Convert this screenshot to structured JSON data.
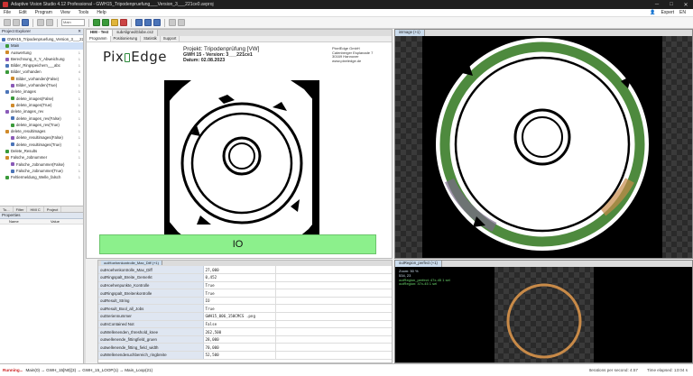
{
  "window": {
    "title": "Adaptive Vision Studio 4.12 Professional - GWH15_Tripodenpruefung___Version_3___221ce0.avproj",
    "minimize": "─",
    "maximize": "□",
    "close": "✕"
  },
  "menu": {
    "items": [
      "File",
      "Edit",
      "Program",
      "View",
      "Tools",
      "Help"
    ],
    "user": "Expert",
    "lang": "EN"
  },
  "toolbar": {
    "dropdown": "Main"
  },
  "project_explorer": {
    "title": "Project Explorer",
    "items": [
      {
        "label": "GWH15_Tripodenpruefung_Version_3___221ce0",
        "line": "",
        "sel": false
      },
      {
        "label": "Main",
        "line": "",
        "sel": true
      },
      {
        "label": "Auswertung",
        "line": "1",
        "sel": false
      },
      {
        "label": "Berechnung_X_Y_Abweichung",
        "line": "1",
        "sel": false
      },
      {
        "label": "Bilder_Ringspeichern___abc",
        "line": "1",
        "sel": false
      },
      {
        "label": "Bilder_vorhanden",
        "line": "4",
        "sel": false
      },
      {
        "label": "Bilder_vorhanden(False)",
        "line": "1",
        "sel": false
      },
      {
        "label": "Bilder_vorhanden(True)",
        "line": "1",
        "sel": false
      },
      {
        "label": "delete_images",
        "line": "1",
        "sel": false
      },
      {
        "label": "delete_images(False)",
        "line": "1",
        "sel": false
      },
      {
        "label": "delete_images(True)",
        "line": "1",
        "sel": false
      },
      {
        "label": "delete_images_rev",
        "line": "1",
        "sel": false
      },
      {
        "label": "delete_images_rev(False)",
        "line": "1",
        "sel": false
      },
      {
        "label": "delete_images_rev(True)",
        "line": "1",
        "sel": false
      },
      {
        "label": "delete_resultimages",
        "line": "1",
        "sel": false
      },
      {
        "label": "delete_resultimages(False)",
        "line": "1",
        "sel": false
      },
      {
        "label": "delete_resultimages(True)",
        "line": "1",
        "sel": false
      },
      {
        "label": "Delete_Results",
        "line": "1",
        "sel": false
      },
      {
        "label": "Falsche_Jobnummer",
        "line": "1",
        "sel": false
      },
      {
        "label": "Falsche_Jobnummer(False)",
        "line": "1",
        "sel": false
      },
      {
        "label": "Falsche_Jobnummer(True)",
        "line": "1",
        "sel": false
      },
      {
        "label": "Fehlermeldung_Welle_falsch",
        "line": "1",
        "sel": false
      }
    ],
    "tabs": [
      "To...",
      "Filter",
      "HMI C",
      "Project"
    ]
  },
  "properties": {
    "title": "Properties",
    "col_name": "Name",
    "col_value": "Value"
  },
  "center": {
    "tabs": [
      "HMI - Test",
      "subAlignedGlobe.cs2"
    ],
    "subtabs": [
      "Programm",
      "Positionierung",
      "Statistik",
      "Support"
    ],
    "report": {
      "logo_pre": "Pix",
      "logo_post": "Edge",
      "project_line": "Projekt: Tripodenprüfung [VW]",
      "gwh_line": "GWH 15 - Version: 3___221ce1",
      "date_line": "Datum: 02.08.2023",
      "address": [
        "PixelEdge GmbH",
        "Calenberger Esplanade 7",
        "30169 Hannover",
        "www.pixeledge.de"
      ]
    },
    "io_label": "IO"
  },
  "right_view": {
    "tab": "inImage (+1)",
    "zoom_line1": "Zoom: 139 %",
    "zoom_line2": "543, 57"
  },
  "bottom_left": {
    "tab": "outHoehenkontrolle_Max_Diff (+1)",
    "rows": [
      {
        "key": "outHoehenkontrolle_Max_Diff",
        "value": "27,000"
      },
      {
        "key": "outRingspalt_Breite_Gemerkt",
        "value": "0,452"
      },
      {
        "key": "outHoehenpunkte_Kontrolle",
        "value": "True"
      },
      {
        "key": "outRingspalt_Breitenkontrolle",
        "value": "True"
      },
      {
        "key": "outResult_String",
        "value": "IO"
      },
      {
        "key": "outResult_Bool_all_Jobs",
        "value": "True"
      },
      {
        "key": "outSeriennummer",
        "value": "GWH15_006_150CMCS    .png"
      },
      {
        "key": "outIsContained Not",
        "value": "False"
      },
      {
        "key": "outWellenenden_threshold_knee",
        "value": "262,500"
      },
      {
        "key": "outwellenende_fittingfield_gruen",
        "value": "28,000"
      },
      {
        "key": "outwellenende_fitting_field_width",
        "value": "70,000"
      },
      {
        "key": "outWellenendesuchbereich_ringbreite",
        "value": "52,500"
      }
    ]
  },
  "bottom_right": {
    "tab": "outRegion_perfect (+1)",
    "lines": [
      "Zoom: 50 %",
      "534, 23",
      "outRegion_perfect: 47x-45 1 sel",
      "outRegion: 47x-45 1 sel"
    ]
  },
  "status": {
    "running": "Running...",
    "path": "Main(0) → GWH_15[N0](3) → GWH_15_LOOP(1) → Main_Loop(21)",
    "fps": "Iterations per second: 4.57",
    "elapsed": "Time elapsed: 13:04 s"
  },
  "colors": {
    "io_green": "#8cf08c",
    "ring_green": "#4e8a3e",
    "ring_orange": "#c88a48"
  }
}
